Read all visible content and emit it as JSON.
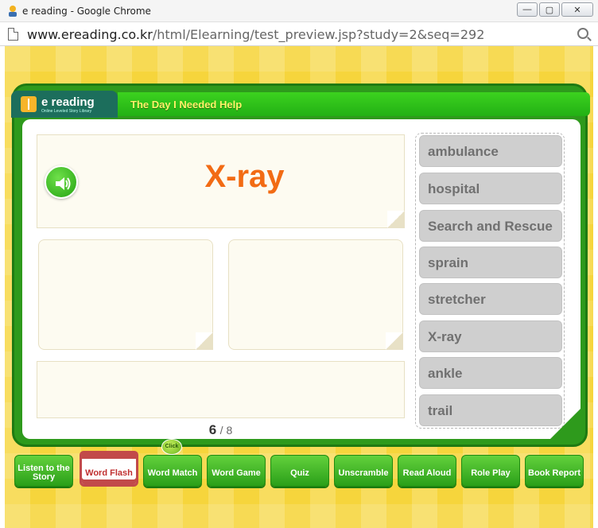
{
  "window": {
    "title": "e reading - Google Chrome",
    "buttons": {
      "minimize": "—",
      "maximize": "▢",
      "close": "✕"
    }
  },
  "address": {
    "host": "www.ereading.co.kr",
    "path": "/html/Elearning/test_preview.jsp?study=2&seq=292"
  },
  "header": {
    "logo": "e reading",
    "logo_sub": "Online Leveled Story Library",
    "story_title": "The Day I Needed Help"
  },
  "flashcard": {
    "word": "X-ray",
    "current": "6",
    "total": "/ 8"
  },
  "word_list": [
    "ambulance",
    "hospital",
    "Search and Rescue",
    "sprain",
    "stretcher",
    "X-ray",
    "ankle",
    "trail"
  ],
  "nav": {
    "click_hint": "Click",
    "items": [
      "Listen to the Story",
      "Word Flash",
      "Word Match",
      "Word Game",
      "Quiz",
      "Unscramble",
      "Read Aloud",
      "Role Play",
      "Book Report"
    ]
  },
  "colors": {
    "stage": "#f6d53c",
    "board": "#2e9a1c",
    "word": "#f26b14",
    "story_title": "#fff36a",
    "word_button": "#cfcfcf"
  }
}
